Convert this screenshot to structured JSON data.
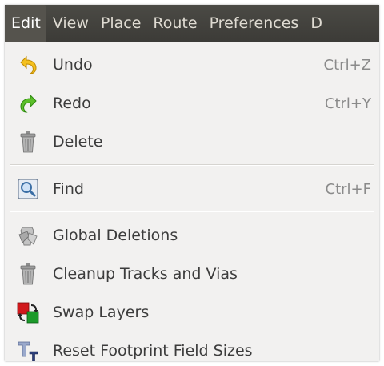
{
  "menubar": {
    "items": [
      "Edit",
      "View",
      "Place",
      "Route",
      "Preferences",
      "D"
    ],
    "active": "Edit"
  },
  "edit_menu": {
    "items": [
      {
        "label": "Undo",
        "shortcut": "Ctrl+Z",
        "icon": "undo-icon"
      },
      {
        "label": "Redo",
        "shortcut": "Ctrl+Y",
        "icon": "redo-icon"
      },
      {
        "label": "Delete",
        "shortcut": "",
        "icon": "trash-icon"
      },
      {
        "label": "Find",
        "shortcut": "Ctrl+F",
        "icon": "find-icon"
      },
      {
        "label": "Global Deletions",
        "shortcut": "",
        "icon": "global-deletions-icon"
      },
      {
        "label": "Cleanup Tracks and Vias",
        "shortcut": "",
        "icon": "trash-icon"
      },
      {
        "label": "Swap Layers",
        "shortcut": "",
        "icon": "swap-layers-icon"
      },
      {
        "label": "Reset Footprint Field Sizes",
        "shortcut": "",
        "icon": "reset-field-sizes-icon"
      }
    ]
  },
  "colors": {
    "menubar_bg": "#3c3b37",
    "menu_bg": "#f2f1f0",
    "menubar_text": "#dfdbd2"
  }
}
